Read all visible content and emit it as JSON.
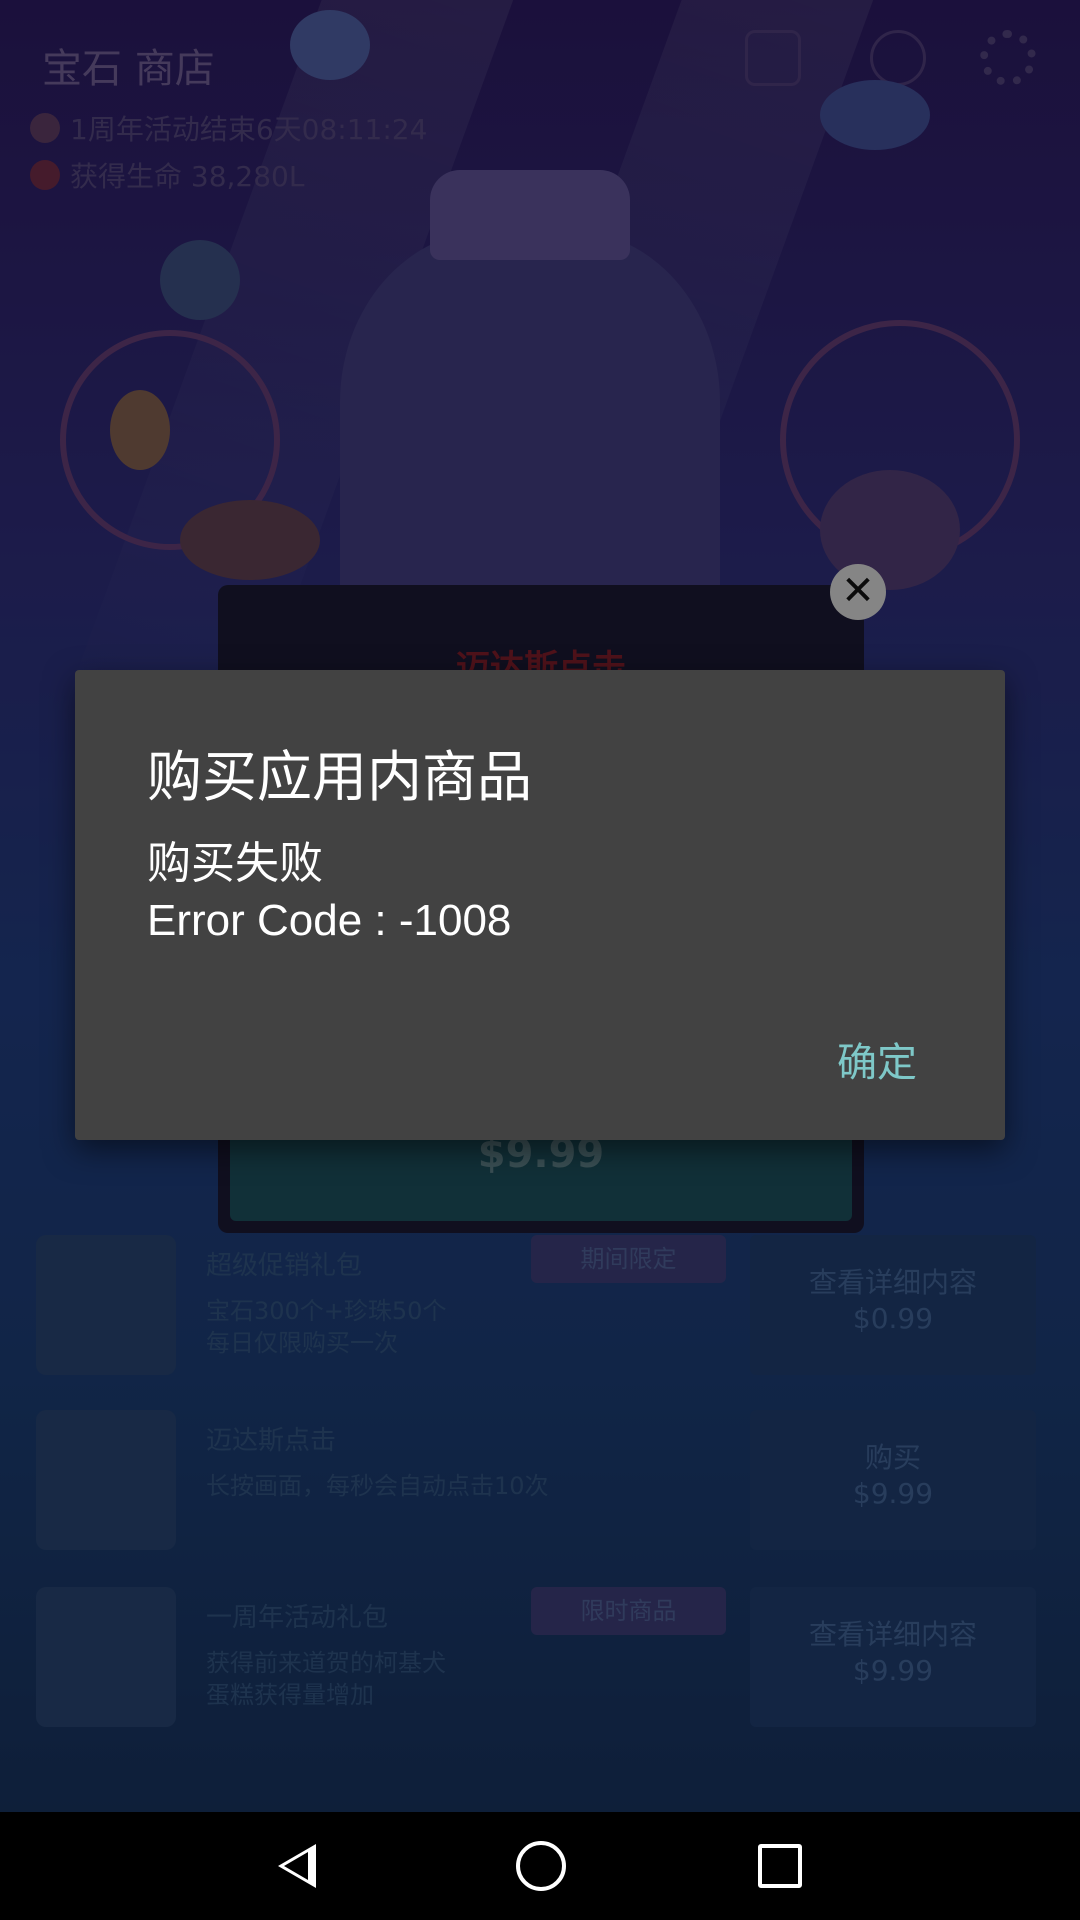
{
  "game": {
    "shop_title": "宝石 商店",
    "event_timer": "1周年活动结束6天08:11:24",
    "life_gained": "获得生命 38,280L",
    "offer_card": {
      "title": "迈达斯点击",
      "price": "$9.99"
    },
    "shop_rows": [
      {
        "title": "超级促销礼包",
        "badge": "期间限定",
        "desc_line1": "宝石300个+珍珠50个",
        "desc_line2": "每日仅限购买一次",
        "action_line1": "查看详细内容",
        "action_line2": "$0.99"
      },
      {
        "title": "迈达斯点击",
        "badge": "",
        "desc_line1": "长按画面，每秒会自动点击10次",
        "desc_line2": "",
        "action_line1": "购买",
        "action_line2": "$9.99"
      },
      {
        "title": "一周年活动礼包",
        "badge": "限时商品",
        "desc_line1": "获得前来道贺的柯基犬",
        "desc_line2": "蛋糕获得量增加",
        "action_line1": "查看详细内容",
        "action_line2": "$9.99"
      }
    ]
  },
  "dialog": {
    "title": "购买应用内商品",
    "message": "购买失败",
    "error": "Error Code : -1008",
    "ok_label": "确定"
  },
  "navbar": {
    "back_icon": "back-triangle",
    "home_icon": "home-circle",
    "recent_icon": "recents-square"
  },
  "colors": {
    "dialog_bg": "#424242",
    "accent": "#7ec8c8"
  }
}
